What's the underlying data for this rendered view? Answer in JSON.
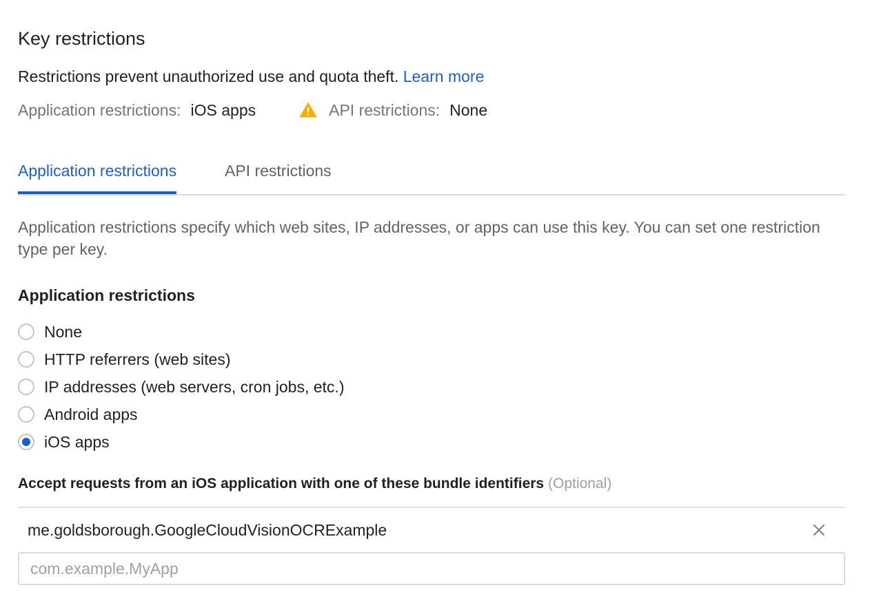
{
  "header": {
    "title": "Key restrictions",
    "description": "Restrictions prevent unauthorized use and quota theft.",
    "learn_more": "Learn more"
  },
  "summary": {
    "app_label": "Application restrictions:",
    "app_value": "iOS apps",
    "api_label": "API restrictions:",
    "api_value": "None",
    "warning_icon": "warning-icon",
    "warning_color": "#f9ab00"
  },
  "tabs": [
    {
      "label": "Application restrictions",
      "active": true
    },
    {
      "label": "API restrictions",
      "active": false
    }
  ],
  "help_text": "Application restrictions specify which web sites, IP addresses, or apps can use this key. You can set one restriction type per key.",
  "restrictions": {
    "heading": "Application restrictions",
    "options": [
      {
        "label": "None",
        "selected": false
      },
      {
        "label": "HTTP referrers (web sites)",
        "selected": false
      },
      {
        "label": "IP addresses (web servers, cron jobs, etc.)",
        "selected": false
      },
      {
        "label": "Android apps",
        "selected": false
      },
      {
        "label": "iOS apps",
        "selected": true
      }
    ]
  },
  "bundle": {
    "heading": "Accept requests from an iOS application with one of these bundle identifiers",
    "optional": "(Optional)",
    "items": [
      "me.goldsborough.GoogleCloudVisionOCRExample"
    ],
    "placeholder": "com.example.MyApp",
    "value": ""
  },
  "colors": {
    "accent": "#1a5fd0",
    "muted": "#757575"
  }
}
